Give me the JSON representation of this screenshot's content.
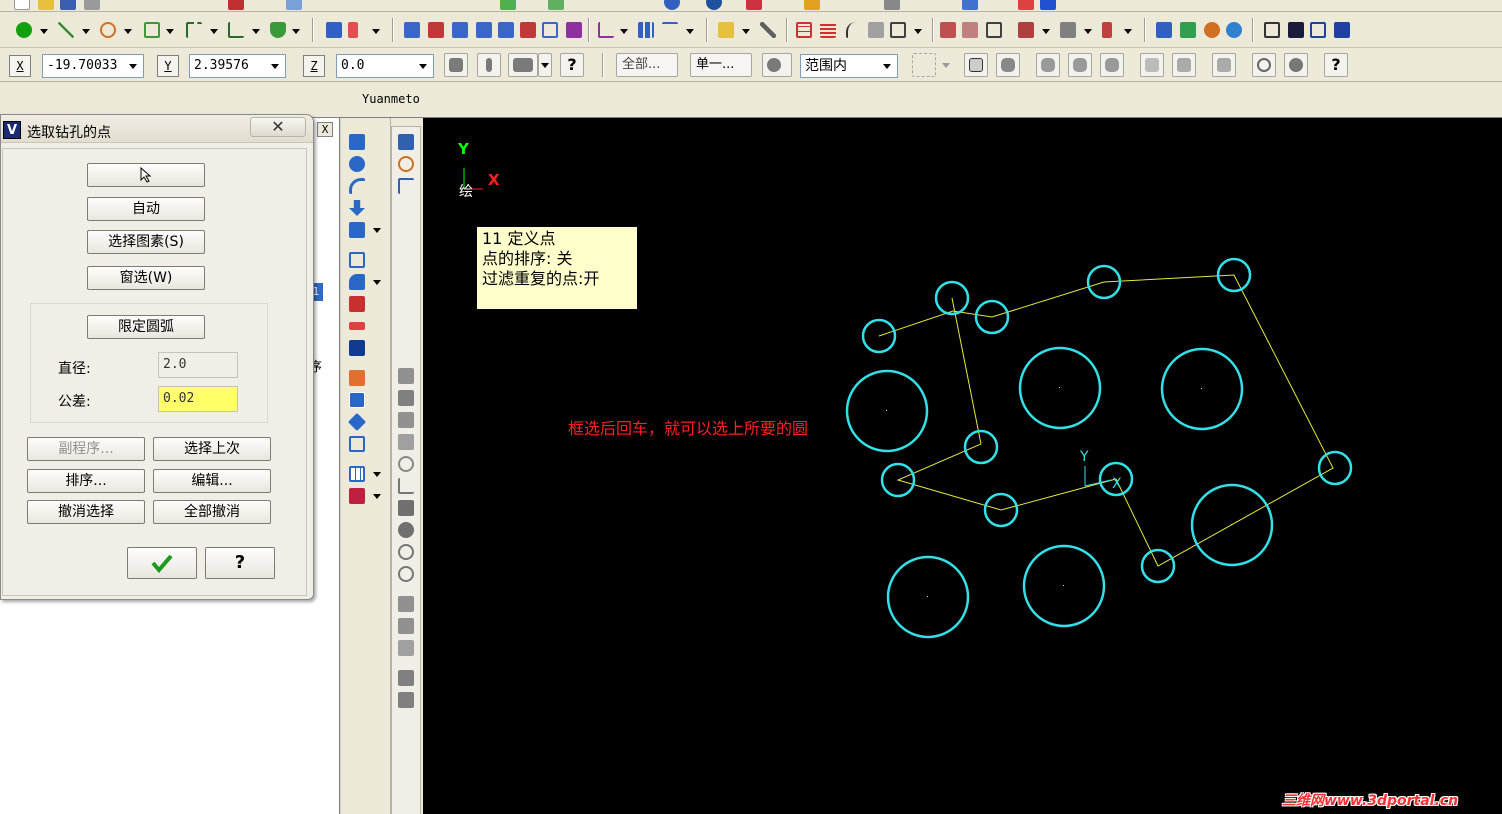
{
  "toolbar": {
    "x_label": "X",
    "x_value": "-19.70033",
    "y_label": "Y",
    "y_value": "2.39576",
    "z_label": "Z",
    "z_value": "0.0",
    "all_label": "全部...",
    "single_label": "单一...",
    "range_label": "范围内"
  },
  "document": {
    "name": "Yuanmeto"
  },
  "left_panel": {
    "close_label": "X",
    "fragment_1": "1",
    "fragment_2": "序"
  },
  "dialog": {
    "title": "选取钻孔的点",
    "close_glyph": "✕",
    "buttons": {
      "auto": "自动",
      "select_entities": "选择图素(S)",
      "window_select": "窗选(W)",
      "limit_arc": "限定圆弧",
      "sub_program": "副程序...",
      "select_last": "选择上次",
      "sort": "排序...",
      "edit": "编辑...",
      "cancel_select": "撤消选择",
      "cancel_all": "全部撤消",
      "help": "?"
    },
    "diameter_label": "直径:",
    "diameter_value": "2.0",
    "tolerance_label": "公差:",
    "tolerance_value": "0.02"
  },
  "canvas": {
    "axis_y": "Y",
    "axis_x": "X",
    "view_label": "绘",
    "origin_y": "Y",
    "origin_x": "X",
    "tooltip": {
      "line1": "11 定义点",
      "line2": "点的排序: 关",
      "line3": "过滤重复的点:开"
    },
    "annotation": "框选后回车，就可以选上所要的圆",
    "watermark": "三维网www.3dportal.cn"
  },
  "colors": {
    "canvas_bg": "#000000",
    "circle": "#33e0e8",
    "toolpath": "#e8e840",
    "annotation": "#ff2020",
    "tolerance_field": "#ffff6a",
    "tooltip_bg": "#ffffcc"
  },
  "icons": {
    "cursor": "cursor-icon",
    "ok": "checkmark-icon",
    "window_control": "close-icon"
  }
}
